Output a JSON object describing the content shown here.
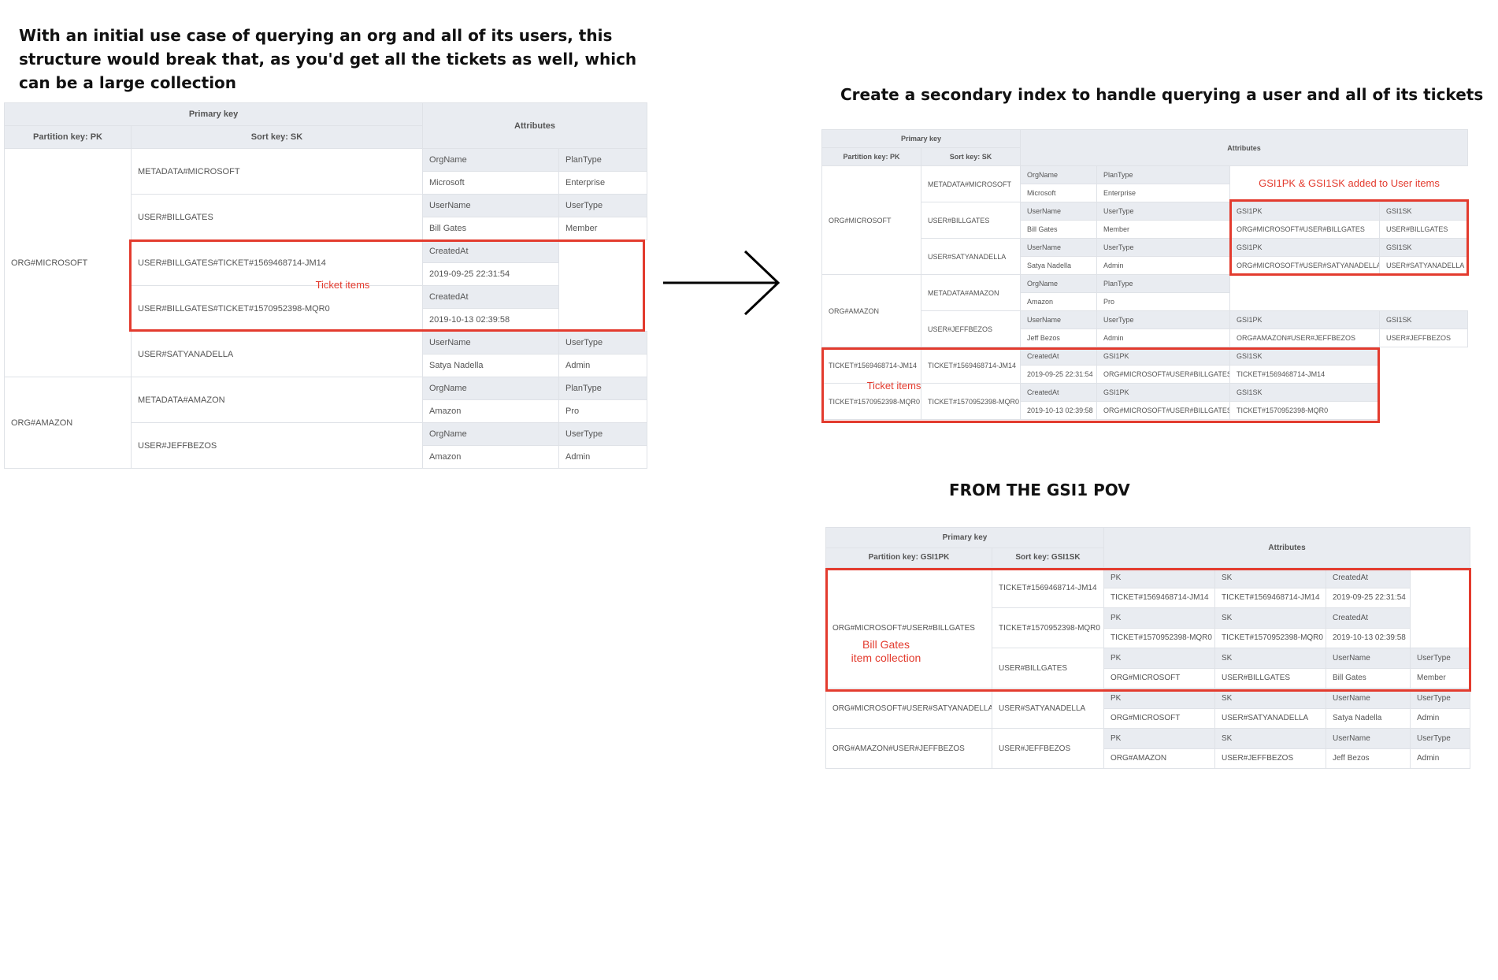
{
  "heading1": {
    "line1": "With an initial use case of querying an org and all of its users, this",
    "line2": "structure would break that, as you'd get all the tickets as well, which",
    "line3": "can be a large collection"
  },
  "heading2": "Create a secondary index to handle querying a user and all of its tickets",
  "heading3": "FROM THE GSI1 POV",
  "table1": {
    "primary_key": "Primary key",
    "partition_key": "Partition key: PK",
    "sort_key": "Sort key: SK",
    "attributes": "Attributes",
    "org_microsoft": "ORG#MICROSOFT",
    "org_amazon": "ORG#AMAZON",
    "sk": [
      "METADATA#MICROSOFT",
      "USER#BILLGATES",
      "USER#BILLGATES#TICKET#1569468714-JM14",
      "USER#BILLGATES#TICKET#1570952398-MQR0",
      "USER#SATYANADELLA",
      "METADATA#AMAZON",
      "USER#JEFFBEZOS"
    ],
    "attrs": [
      [
        "OrgName",
        "PlanType",
        "Microsoft",
        "Enterprise"
      ],
      [
        "UserName",
        "UserType",
        "Bill Gates",
        "Member"
      ],
      [
        "CreatedAt",
        "2019-09-25 22:31:54"
      ],
      [
        "CreatedAt",
        "2019-10-13 02:39:58"
      ],
      [
        "UserName",
        "UserType",
        "Satya Nadella",
        "Admin"
      ],
      [
        "OrgName",
        "PlanType",
        "Amazon",
        "Pro"
      ],
      [
        "OrgName",
        "UserType",
        "Amazon",
        "Admin"
      ]
    ],
    "annotation": "Ticket items"
  },
  "table2": {
    "primary_key": "Primary key",
    "partition_key": "Partition key: PK",
    "sort_key": "Sort key: SK",
    "attributes": "Attributes",
    "pk": [
      "ORG#MICROSOFT",
      "ORG#AMAZON",
      "TICKET#1569468714-JM14",
      "TICKET#1570952398-MQR0"
    ],
    "sk": [
      "METADATA#MICROSOFT",
      "USER#BILLGATES",
      "USER#SATYANADELLA",
      "METADATA#AMAZON",
      "USER#JEFFBEZOS",
      "TICKET#1569468714-JM14",
      "TICKET#1570952398-MQR0"
    ],
    "attrs": [
      [
        "OrgName",
        "PlanType",
        "Microsoft",
        "Enterprise"
      ],
      [
        "UserName",
        "UserType",
        "GSI1PK",
        "GSI1SK",
        "Bill Gates",
        "Member",
        "ORG#MICROSOFT#USER#BILLGATES",
        "USER#BILLGATES"
      ],
      [
        "UserName",
        "UserType",
        "GSI1PK",
        "GSI1SK",
        "Satya Nadella",
        "Admin",
        "ORG#MICROSOFT#USER#SATYANADELLA",
        "USER#SATYANADELLA"
      ],
      [
        "OrgName",
        "PlanType",
        "Amazon",
        "Pro"
      ],
      [
        "UserName",
        "UserType",
        "GSI1PK",
        "GSI1SK",
        "Jeff Bezos",
        "Admin",
        "ORG#AMAZON#USER#JEFFBEZOS",
        "USER#JEFFBEZOS"
      ],
      [
        "CreatedAt",
        "GSI1PK",
        "GSI1SK",
        "2019-09-25 22:31:54",
        "ORG#MICROSOFT#USER#BILLGATES",
        "TICKET#1569468714-JM14"
      ],
      [
        "CreatedAt",
        "GSI1PK",
        "GSI1SK",
        "2019-10-13 02:39:58",
        "ORG#MICROSOFT#USER#BILLGATES",
        "TICKET#1570952398-MQR0"
      ]
    ],
    "annotation_gsi": "GSI1PK & GSI1SK added to User items",
    "annotation_tickets": "Ticket items"
  },
  "table3": {
    "primary_key": "Primary key",
    "partition_key": "Partition key: GSI1PK",
    "sort_key": "Sort key: GSI1SK",
    "attributes": "Attributes",
    "gsi1pk": [
      "ORG#MICROSOFT#USER#BILLGATES",
      "ORG#MICROSOFT#USER#SATYANADELLA",
      "ORG#AMAZON#USER#JEFFBEZOS"
    ],
    "gsi1sk": [
      "TICKET#1569468714-JM14",
      "TICKET#1570952398-MQR0",
      "USER#BILLGATES",
      "USER#SATYANADELLA",
      "USER#JEFFBEZOS"
    ],
    "attrs": [
      [
        "PK",
        "SK",
        "CreatedAt",
        "TICKET#1569468714-JM14",
        "TICKET#1569468714-JM14",
        "2019-09-25 22:31:54"
      ],
      [
        "PK",
        "SK",
        "CreatedAt",
        "TICKET#1570952398-MQR0",
        "TICKET#1570952398-MQR0",
        "2019-10-13 02:39:58"
      ],
      [
        "PK",
        "SK",
        "UserName",
        "UserType",
        "ORG#MICROSOFT",
        "USER#BILLGATES",
        "Bill Gates",
        "Member"
      ],
      [
        "PK",
        "SK",
        "UserName",
        "UserType",
        "ORG#MICROSOFT",
        "USER#SATYANADELLA",
        "Satya Nadella",
        "Admin"
      ],
      [
        "PK",
        "SK",
        "UserName",
        "UserType",
        "ORG#AMAZON",
        "USER#JEFFBEZOS",
        "Jeff Bezos",
        "Admin"
      ]
    ],
    "annotation_line1": "Bill Gates",
    "annotation_line2": "item collection"
  },
  "colors": {
    "highlight": "#e33b2e",
    "header_bg": "#e9ecf1"
  }
}
